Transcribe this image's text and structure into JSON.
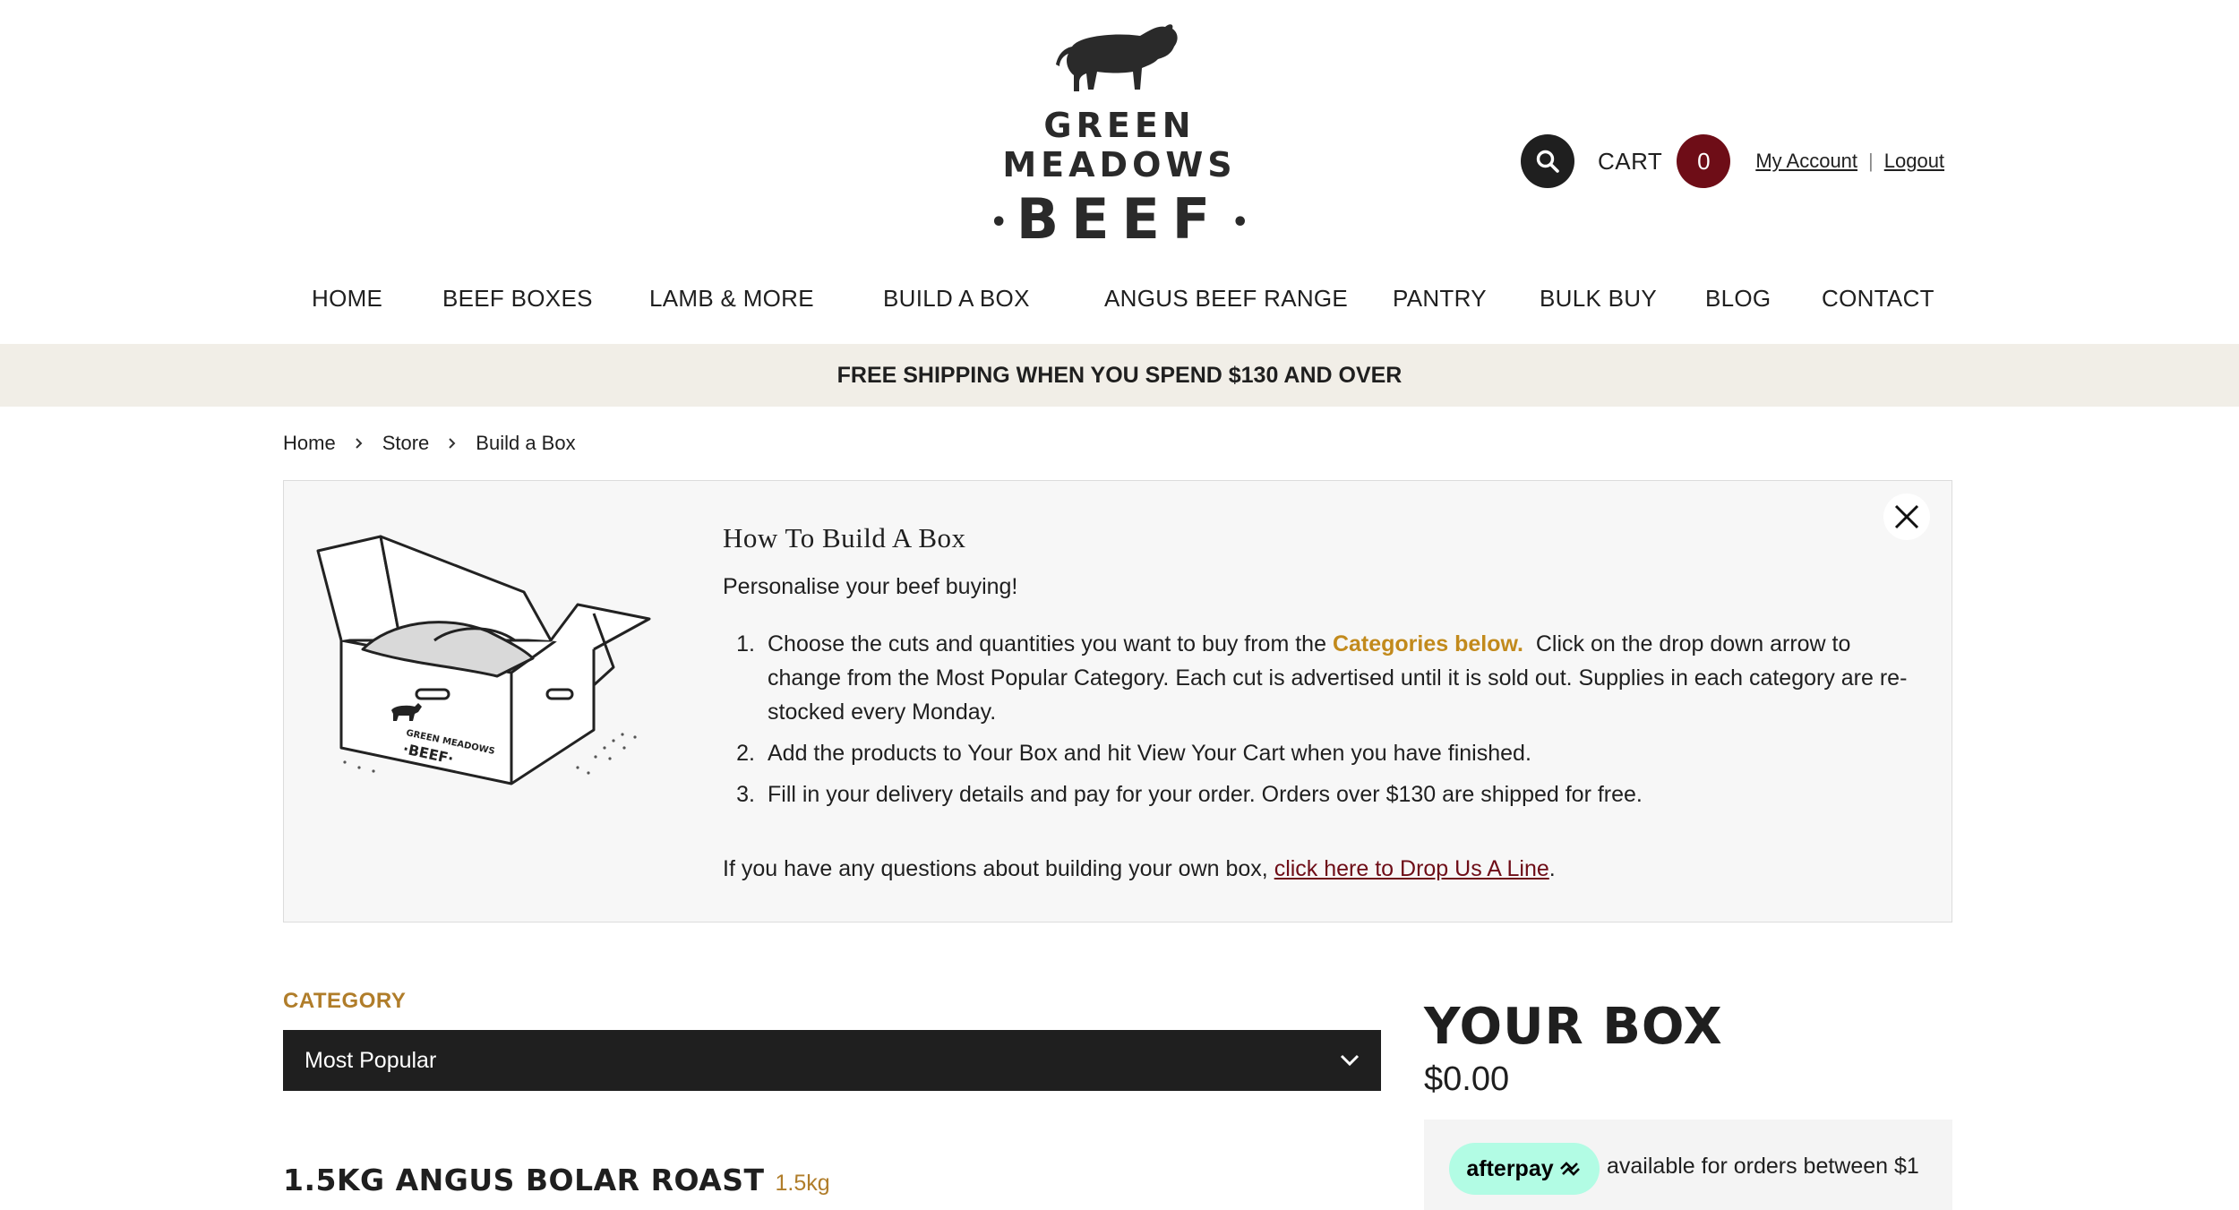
{
  "brand": {
    "line1": "GREEN MEADOWS",
    "line2": "BEEF",
    "dot": "•"
  },
  "header": {
    "cart_label": "CART",
    "cart_count": "0",
    "my_account": "My Account",
    "separator": "|",
    "logout": "Logout"
  },
  "nav": {
    "items": [
      "HOME",
      "BEEF BOXES",
      "LAMB & MORE",
      "BUILD A BOX",
      "ANGUS BEEF RANGE",
      "PANTRY",
      "BULK BUY",
      "BLOG",
      "CONTACT"
    ]
  },
  "banner": {
    "text": "FREE SHIPPING WHEN YOU SPEND $130 AND OVER"
  },
  "breadcrumb": {
    "items": [
      "Home",
      "Store",
      "Build a Box"
    ]
  },
  "info": {
    "title": "How To Build A Box",
    "subtitle": "Personalise your beef buying!",
    "steps": [
      {
        "num": "1.",
        "before": "Choose the cuts and quantities you want to buy from the ",
        "highlight": "Categories below.",
        "after": "  Click on the drop down arrow to change from the Most Popular Category. Each cut is advertised until it is sold out. Supplies in each category are re-stocked every Monday."
      },
      {
        "num": "2.",
        "text": "Add the products to Your Box and hit View Your Cart when you have finished."
      },
      {
        "num": "3.",
        "text": "Fill in your delivery details and pay for your order. Orders over $130 are shipped for free."
      }
    ],
    "footer_before": "If you have any questions about building your own box, ",
    "footer_link": "click here to Drop Us A Line",
    "footer_after": "."
  },
  "category": {
    "label": "CATEGORY",
    "selected": "Most Popular"
  },
  "product": {
    "name": "1.5KG ANGUS BOLAR ROAST",
    "weight": "1.5kg"
  },
  "your_box": {
    "title": "YOUR BOX",
    "total": "$0.00",
    "afterpay_label": "afterpay",
    "afterpay_text": "available for orders between $1"
  },
  "colors": {
    "accent_gold": "#b07d2a",
    "cart_badge": "#6e0d17",
    "dark": "#1f1f1f",
    "banner_bg": "#f1eee7",
    "afterpay_mint": "#b2fce4"
  },
  "icons": [
    "cow-icon",
    "search-icon",
    "close-icon",
    "chevron-down-icon",
    "chevron-right-icon",
    "box-illustration",
    "afterpay-arrows-icon"
  ]
}
